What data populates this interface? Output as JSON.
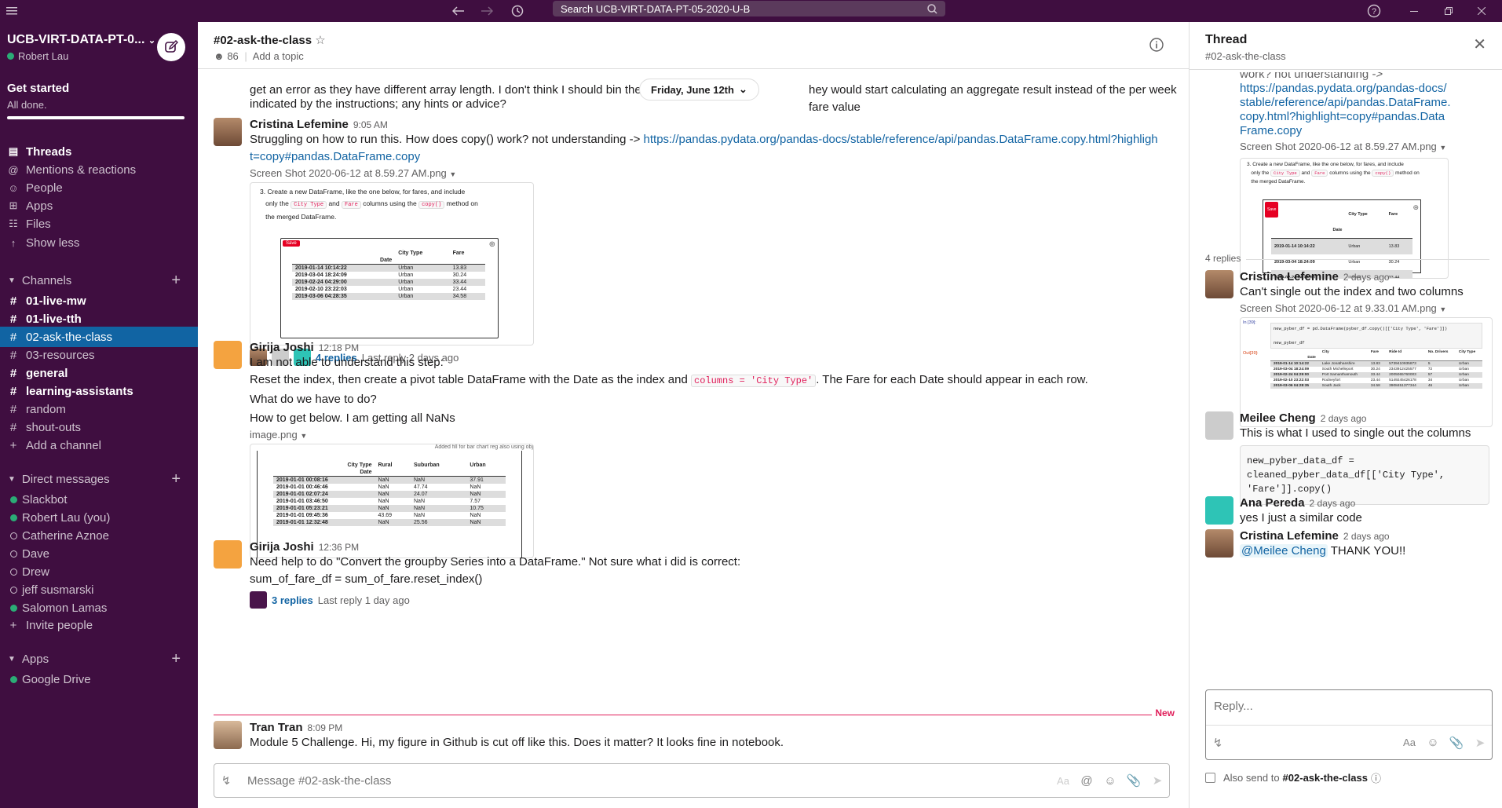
{
  "topbar": {
    "search_placeholder": "Search UCB-VIRT-DATA-PT-05-2020-U-B"
  },
  "workspace": {
    "name": "UCB-VIRT-DATA-PT-0...",
    "user": "Robert Lau"
  },
  "get_started": {
    "title": "Get started",
    "status": "All done."
  },
  "nav": {
    "threads": "Threads",
    "mentions": "Mentions & reactions",
    "people": "People",
    "apps": "Apps",
    "files": "Files",
    "show_less": "Show less"
  },
  "channels": {
    "header": "Channels",
    "items": [
      {
        "name": "01-live-mw"
      },
      {
        "name": "01-live-tth"
      },
      {
        "name": "02-ask-the-class"
      },
      {
        "name": "03-resources"
      },
      {
        "name": "general"
      },
      {
        "name": "learning-assistants"
      },
      {
        "name": "random"
      },
      {
        "name": "shout-outs"
      }
    ],
    "add": "Add a channel"
  },
  "dms": {
    "header": "Direct messages",
    "items": [
      {
        "name": "Slackbot"
      },
      {
        "name": "Robert Lau",
        "suffix": "(you)"
      },
      {
        "name": "Catherine Aznoe"
      },
      {
        "name": "Dave"
      },
      {
        "name": "Drew"
      },
      {
        "name": "jeff susmarski"
      },
      {
        "name": "Salomon Lamas"
      }
    ],
    "invite": "Invite people"
  },
  "apps_section": {
    "header": "Apps",
    "items": [
      {
        "name": "Google Drive"
      }
    ]
  },
  "channel": {
    "name": "#02-ask-the-class",
    "members": "86",
    "topic": "Add a topic"
  },
  "date_divider": "Friday, June 12th",
  "messages": {
    "prev_text": "get an error as they have different array length. I don't think I should bin the",
    "prev_text2": "hey would start calculating an aggregate result instead of the per week fare value",
    "prev_text3": "indicated by the instructions; any hints or advice?",
    "m1": {
      "author": "Cristina Lefemine",
      "time": "9:05 AM",
      "text": "Struggling on how to run this. How does copy() work? not understanding ->",
      "link": "https://pandas.pydata.org/pandas-docs/stable/reference/api/pandas.DataFrame.copy.html?highlight=copy#pandas.DataFrame.copy",
      "file": "Screen Shot 2020-06-12 at 8.59.27 AM.png",
      "replies": "4 replies",
      "last": "Last reply 2 days ago"
    },
    "m2": {
      "author": "Girija Joshi",
      "time": "12:18 PM",
      "line1": "I am not able to understand this step:",
      "line2a": "Reset the index, then create a pivot table DataFrame with the Date as the index and",
      "code": "columns = 'City Type'",
      "line2b": ". The Fare for each Date should appear in each row.",
      "line3": "What do we have to do?",
      "line4": "How to get below. I am getting all NaNs",
      "file": "image.png"
    },
    "m3": {
      "author": "Girija Joshi",
      "time": "12:36 PM",
      "line1": "Need help to do \"Convert the groupby Series into a DataFrame.\" Not sure what i did is correct:",
      "line2": "sum_of_fare_df = sum_of_fare.reset_index()",
      "replies": "3 replies",
      "last": "Last reply 1 day ago"
    },
    "new_label": "New",
    "m4": {
      "author": "Tran Tran",
      "time": "8:09 PM",
      "text": "Module 5 Challenge. Hi, my figure in Github is cut off like this. Does it matter? It looks fine in notebook."
    }
  },
  "screenshot_table": {
    "instr_a": "3. Create a new DataFrame, like the one below, for fares, and include",
    "instr_b": "only the",
    "instr_code1": "City Type",
    "instr_c": "and",
    "instr_code2": "Fare",
    "instr_d": "columns using the",
    "instr_code3": "copy()",
    "instr_e": "method on",
    "instr_f": "the merged DataFrame.",
    "save": "Save",
    "col1": "City Type",
    "col2": "Fare",
    "idx": "Date",
    "rows": [
      [
        "2019-01-14 10:14:22",
        "Urban",
        "13.83"
      ],
      [
        "2019-03-04 18:24:09",
        "Urban",
        "30.24"
      ],
      [
        "2019-02-24 04:29:00",
        "Urban",
        "33.44"
      ],
      [
        "2019-02-10 23:22:03",
        "Urban",
        "23.44"
      ],
      [
        "2019-03-06 04:28:35",
        "Urban",
        "34.58"
      ]
    ]
  },
  "pivot_table": {
    "note": "Added fill for bar chart reg also using obj",
    "cols": [
      "City Type",
      "Rural",
      "Suburban",
      "Urban"
    ],
    "idx": "Date",
    "rows": [
      [
        "2019-01-01 00:08:16",
        "NaN",
        "NaN",
        "37.91"
      ],
      [
        "2019-01-01 00:46:46",
        "NaN",
        "47.74",
        "NaN"
      ],
      [
        "2019-01-01 02:07:24",
        "NaN",
        "24.07",
        "NaN"
      ],
      [
        "2019-01-01 03:46:50",
        "NaN",
        "NaN",
        "7.57"
      ],
      [
        "2019-01-01 05:23:21",
        "NaN",
        "NaN",
        "10.75"
      ],
      [
        "2019-01-01 09:45:36",
        "43.69",
        "NaN",
        "NaN"
      ],
      [
        "2019-01-01 12:32:48",
        "NaN",
        "25.56",
        "NaN"
      ]
    ]
  },
  "thread": {
    "title": "Thread",
    "channel": "#02-ask-the-class",
    "top_partial": "work? not understanding ->",
    "link": "https://pandas.pydata.org/pandas-docs/stable/reference/api/pandas.DataFrame.copy.html?highlight=copy#pandas.DataFrame.copy",
    "file": "Screen Shot 2020-06-12 at 8.59.27 AM.png",
    "count": "4 replies",
    "r1": {
      "author": "Cristina Lefemine",
      "time": "2 days ago",
      "text": "Can't single out the index and two columns",
      "file": "Screen Shot 2020-06-12 at 9.33.01 AM.png"
    },
    "r2": {
      "author": "Meilee Cheng",
      "time": "2 days ago",
      "text": "This is what I used to single out the columns",
      "code": "new_pyber_data_df = cleaned_pyber_data_df[['City Type', 'Fare']].copy()"
    },
    "r3": {
      "author": "Ana Pereda",
      "time": "2 days ago",
      "text": "yes I just a similar code"
    },
    "r4": {
      "author": "Cristina Lefemine",
      "time": "2 days ago",
      "mention": "@Meilee Cheng",
      "text": "THANK YOU!!"
    },
    "reply_placeholder": "Reply...",
    "also_send": "Also send to",
    "also_channel": "#02-ask-the-class"
  },
  "composer": {
    "placeholder": "Message #02-ask-the-class"
  },
  "code_screenshot": {
    "in_label": "In [39]:",
    "code_line": "new_pyber_df = pd.DataFrame(pyber_df.copy()[['City Type', 'Fare']])",
    "code_line2": "new_pyber_df",
    "out_label": "Out[39]:",
    "cols": [
      "City",
      "Fare",
      "Ride Id",
      "No. Drivers",
      "City Type"
    ],
    "idx": "Date",
    "rows": [
      [
        "2019-01-14 10:14:22",
        "Lake Jonathanshire",
        "13.83",
        "5739410935873",
        "5",
        "Urban"
      ],
      [
        "2019-03-04 18:24:09",
        "South Michelleport",
        "30.24",
        "2343912425577",
        "72",
        "Urban"
      ],
      [
        "2019-02-24 04:29:00",
        "Port Samanthamouth",
        "33.44",
        "2005065760003",
        "57",
        "Urban"
      ],
      [
        "2019-02-10 23:22:03",
        "Rodneyfort",
        "23.44",
        "5149245426178",
        "34",
        "Urban"
      ],
      [
        "2019-03-06 04:28:35",
        "South Jack",
        "34.58",
        "3908451377344",
        "46",
        "Urban"
      ]
    ]
  }
}
